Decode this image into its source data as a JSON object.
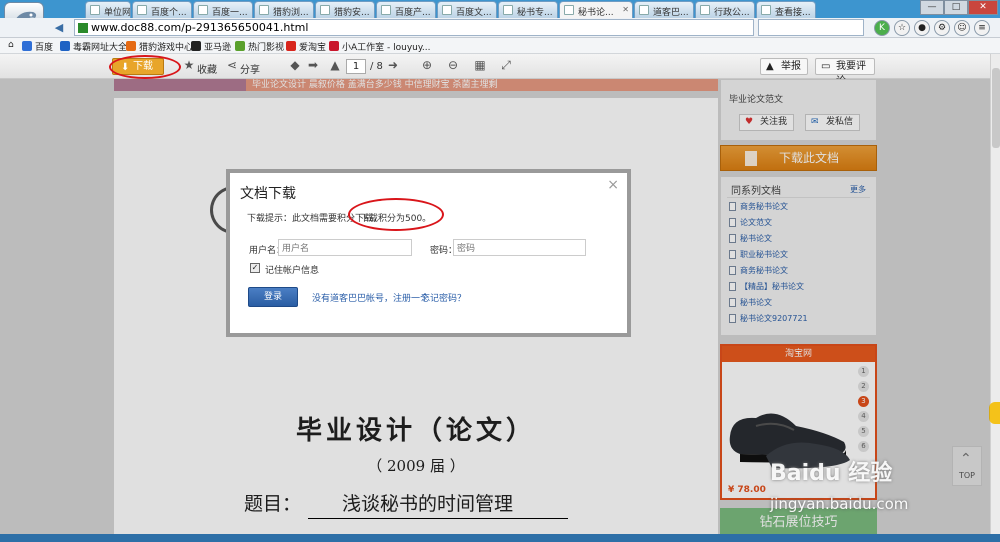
{
  "browser": {
    "tabs": [
      {
        "label": "单位网..."
      },
      {
        "label": "百度个..."
      },
      {
        "label": "百度一..."
      },
      {
        "label": "猎豹浏..."
      },
      {
        "label": "猎豹安..."
      },
      {
        "label": "百度产..."
      },
      {
        "label": "百度文..."
      },
      {
        "label": "秘书专..."
      },
      {
        "label": "秘书论..."
      },
      {
        "label": "道客巴..."
      },
      {
        "label": "行政公..."
      },
      {
        "label": "查看接..."
      }
    ],
    "url": "www.doc88.com/p-291365650041.html",
    "search_placeholder": "",
    "bookmarks": [
      {
        "label": "百度",
        "color": "#2f6fd6"
      },
      {
        "label": "毒霸网址大全",
        "color": "#1e62c4"
      },
      {
        "label": "猎豹游戏中心",
        "color": "#e56a13"
      },
      {
        "label": "亚马逊",
        "color": "#222222"
      },
      {
        "label": "热门影视",
        "color": "#5aa02c"
      },
      {
        "label": "爱淘宝",
        "color": "#d8261d"
      },
      {
        "label": "小A工作室 - louyuy...",
        "color": "#c9162b"
      }
    ]
  },
  "toolbar": {
    "download": "下载",
    "favorite": "收藏",
    "share": "分享",
    "page_current": "1",
    "page_total": "/ 8",
    "report": "举报",
    "comment": "我要评论"
  },
  "document": {
    "title": "毕业设计（论文）",
    "year": "（ 2009 届 ）",
    "topic_label": "题目：",
    "topic": "浅谈秘书的时间管理",
    "banner": "毕业论文设计    晨叙价格    盖满台多少钱    中信理财宝    杀菌主埋剩"
  },
  "modal": {
    "title": "文档下载",
    "close": "×",
    "hint": "下载提示：此文档需要积分下载，",
    "hint_points": "下载积分为500。",
    "username_label": "用户名：",
    "username_placeholder": "用户名",
    "password_label": "密码：",
    "password_placeholder": "密码",
    "remember": "记住帐户信息",
    "login_button": "登录",
    "register_link": "没有道客巴巴帐号，注册一个",
    "forgot_link": "忘记密码？"
  },
  "sidebar": {
    "author_title": "毕业论文范文",
    "follow": "关注我",
    "message": "发私信",
    "download_doc": "下载此文档",
    "related_title": "同系列文档",
    "more": "更多",
    "related": [
      "商务秘书论文",
      "论文范文",
      "秘书论文",
      "职业秘书论文",
      "商务秘书论文",
      "【精品】秘书论文",
      "秘书论文",
      "秘书论文9207721"
    ],
    "taobao_title": "淘宝网",
    "taobao_pages": [
      "1",
      "2",
      "3",
      "4",
      "5",
      "6"
    ],
    "taobao_active": "3",
    "price": "¥ 78.00",
    "green_ad": "钻石展位技巧",
    "top": "TOP"
  },
  "watermark": {
    "line1": "Baidu 经验",
    "line2": "jingyan.baidu.com"
  }
}
